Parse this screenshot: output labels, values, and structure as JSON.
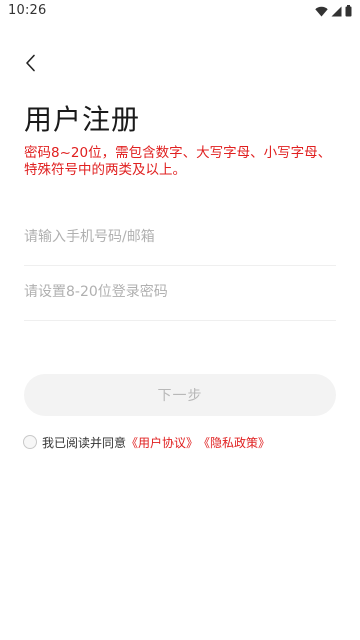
{
  "status_bar": {
    "time": "10:26",
    "icons": [
      "wifi-icon",
      "signal-icon",
      "battery-icon"
    ]
  },
  "header": {
    "back_icon": "chevron-left-icon"
  },
  "page": {
    "title": "用户注册",
    "password_hint": "密码8~20位，需包含数字、大写字母、小写字母、特殊符号中的两类及以上。"
  },
  "form": {
    "phone": {
      "placeholder": "请输入手机号码/邮箱",
      "value": ""
    },
    "password": {
      "placeholder": "请设置8-20位登录密码",
      "value": ""
    },
    "next_label": "下一步"
  },
  "agreement": {
    "checked": false,
    "prefix": "我已阅读并同意",
    "user_agreement": "《用户协议》",
    "privacy_policy": "《隐私政策》"
  },
  "colors": {
    "accent_red": "#e02020",
    "button_bg_disabled": "#f3f3f3",
    "button_text_disabled": "#b8b8b8",
    "placeholder": "#b0b0b0",
    "divider": "#efefef"
  }
}
